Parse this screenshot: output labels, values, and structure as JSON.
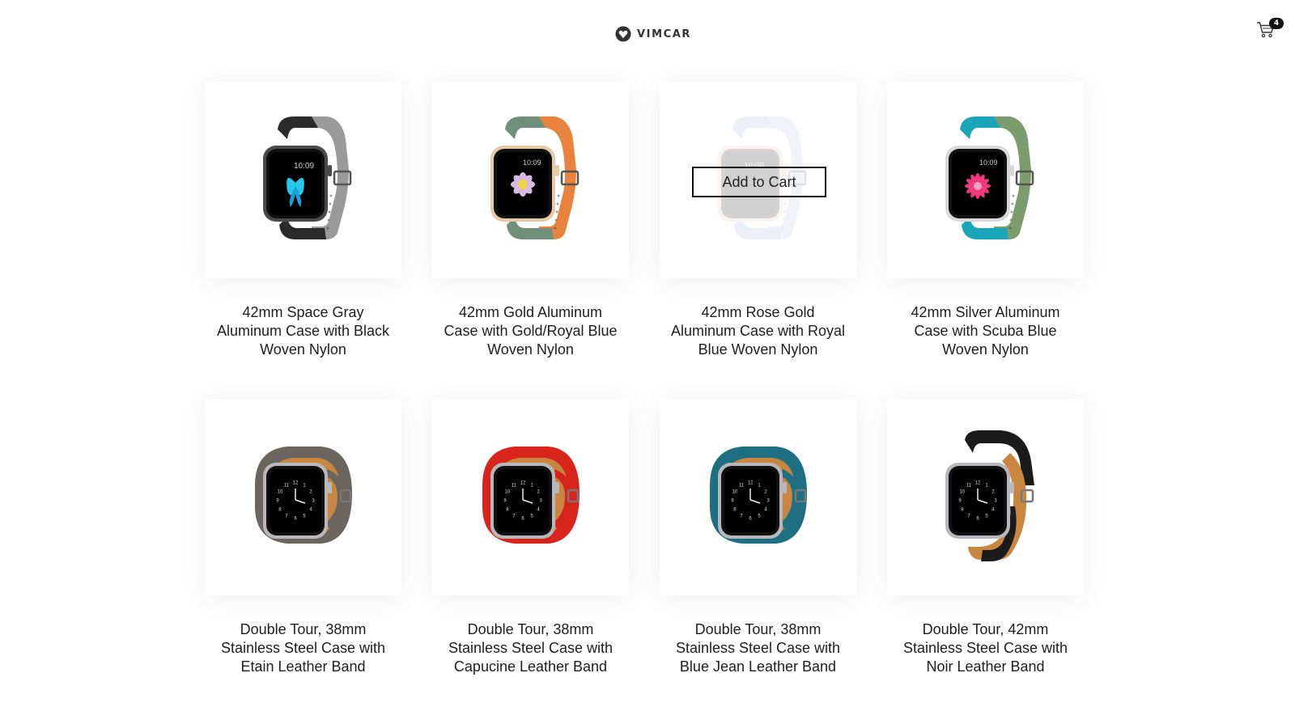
{
  "header": {
    "brand": "VIMCAR",
    "logo_icon": "vimcar-heart-logo",
    "cart_icon": "shopping-cart-icon",
    "cart_count": "4"
  },
  "products": [
    {
      "name": "42mm Space Gray Aluminum Case with Black Woven Nylon",
      "style": "nylon",
      "case": "#4a4a4c",
      "band": "#2b2b2b",
      "band2": "#9a9a9a",
      "screen": "butterfly"
    },
    {
      "name": "42mm Gold Aluminum Case with Gold/Royal Blue Woven Nylon",
      "style": "nylon",
      "case": "#e6c9a6",
      "band": "#6f8f78",
      "band2": "#e8823d",
      "screen": "flower"
    },
    {
      "name": "42mm Rose Gold Aluminum Case with Royal Blue Woven Nylon",
      "style": "nylon",
      "case": "#e9c7b6",
      "band": "#9aa8cf",
      "band2": "#b9c3e0",
      "screen": "clock",
      "hover": true,
      "button": "Add to Cart"
    },
    {
      "name": "42mm Silver Aluminum Case with Scuba Blue Woven Nylon",
      "style": "nylon",
      "case": "#d9d9dc",
      "band": "#1aa6b8",
      "band2": "#7c9c6e",
      "screen": "pinkflower"
    },
    {
      "name": "Double Tour, 38mm Stainless Steel Case with Etain Leather Band",
      "style": "leather",
      "case": "#b8b8bc",
      "band": "#6b6560",
      "band2": "#c98640",
      "screen": "hermes"
    },
    {
      "name": "Double Tour, 38mm Stainless Steel Case with Capucine Leather Band",
      "style": "leather",
      "case": "#b8b8bc",
      "band": "#d8251c",
      "band2": "#c98640",
      "screen": "hermes"
    },
    {
      "name": "Double Tour, 38mm Stainless Steel Case with Blue Jean Leather Band",
      "style": "leather",
      "case": "#b8b8bc",
      "band": "#1f6f82",
      "band2": "#c98640",
      "screen": "hermes"
    },
    {
      "name": "Double Tour, 42mm Stainless Steel Case with Noir Leather Band",
      "style": "leather-single",
      "case": "#b8b8bc",
      "band": "#1b1b1b",
      "band2": "#c98640",
      "screen": "hermes"
    }
  ]
}
